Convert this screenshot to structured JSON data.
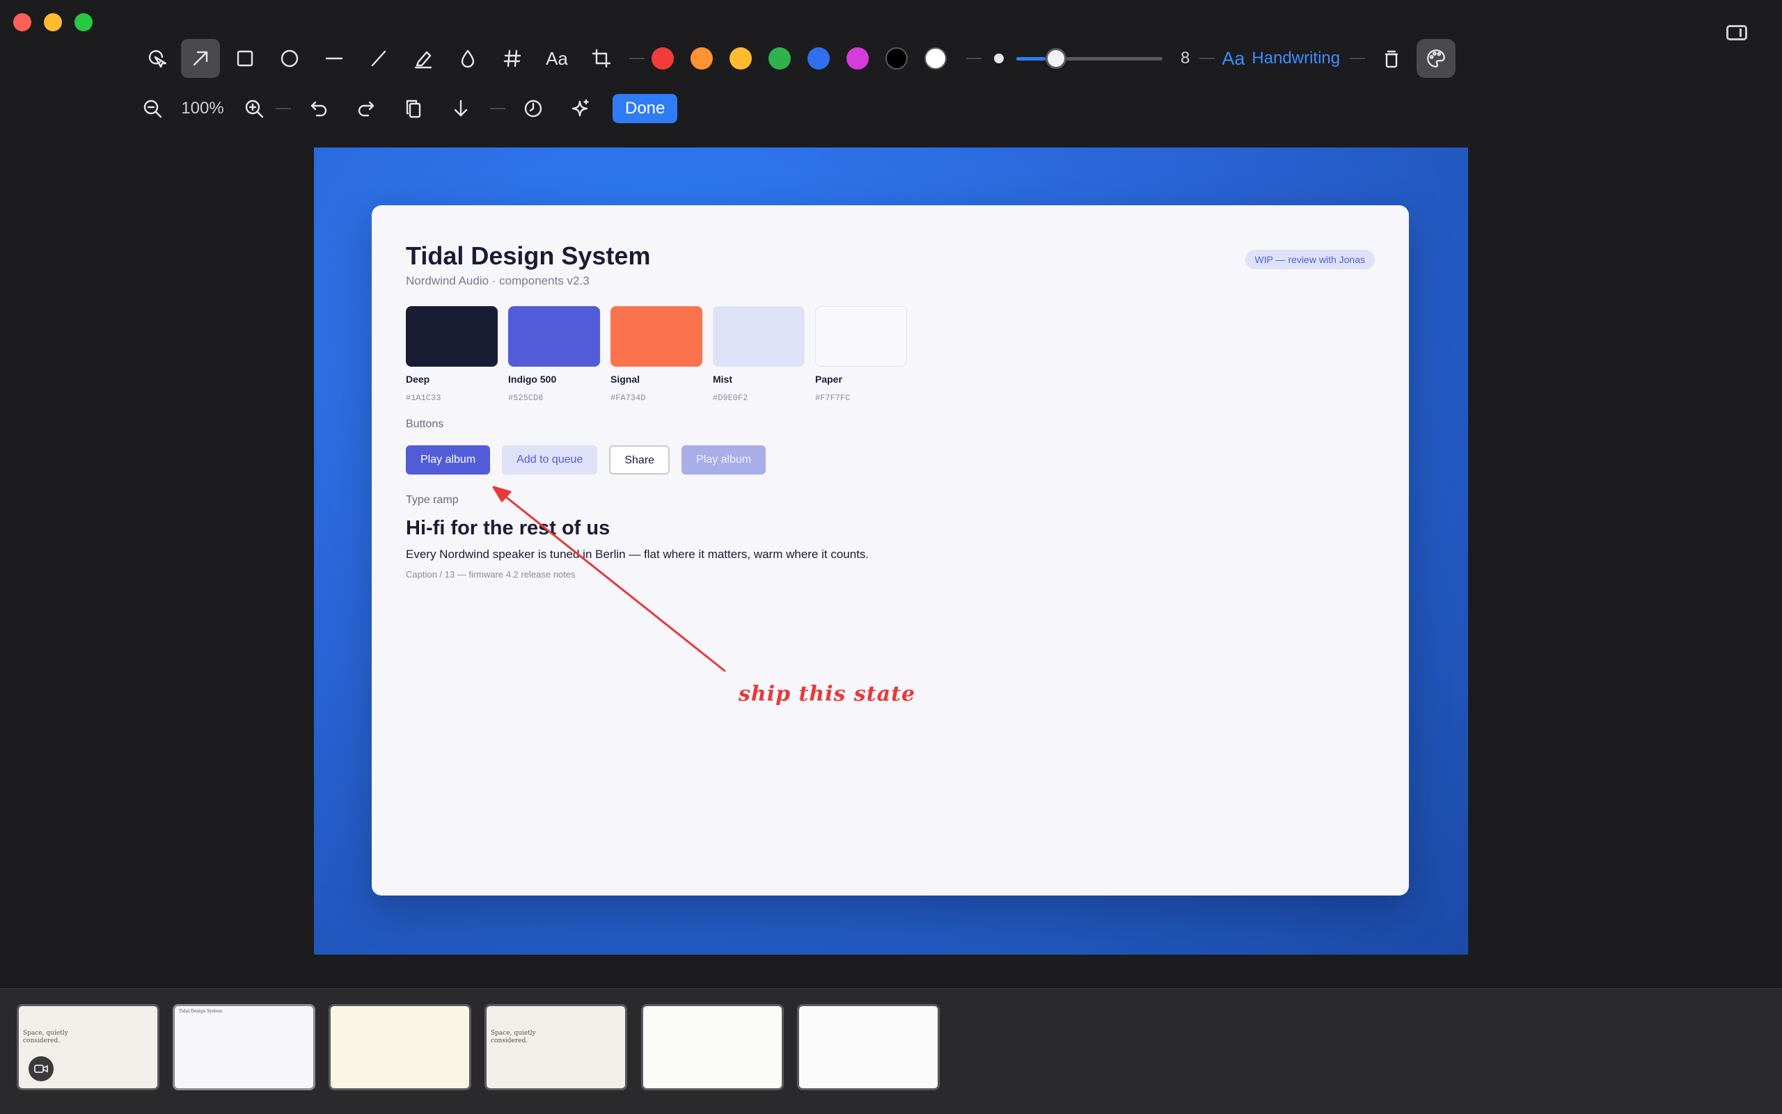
{
  "toolbar": {
    "zoom": "100%",
    "stroke_size": "8",
    "stroke_size_fraction": 0.2,
    "font_style": "Handwriting",
    "font_prefix": "Aa",
    "text_tool": "Aa",
    "done_label": "Done",
    "colors": [
      "#f23c3c",
      "#ff9332",
      "#ffbb2d",
      "#2fb24c",
      "#2f6ff0",
      "#d63bdc",
      "#000000",
      "#ffffff"
    ]
  },
  "card": {
    "title": "Tidal Design System",
    "subtitle": "Nordwind Audio · components v2.3",
    "badge": "WIP — review with Jonas",
    "swatches": [
      {
        "name": "Deep",
        "hex": "#1A1C33",
        "color": "#1a1c33"
      },
      {
        "name": "Indigo 500",
        "hex": "#525CD8",
        "color": "#525cd8"
      },
      {
        "name": "Signal",
        "hex": "#FA734D",
        "color": "#fa734d"
      },
      {
        "name": "Mist",
        "hex": "#D9E0F2",
        "color": "#dfe2f6"
      },
      {
        "name": "Paper",
        "hex": "#F7F7FC",
        "color": "#f7f7fc"
      }
    ],
    "buttons_label": "Buttons",
    "buttons": [
      "Play album",
      "Add to queue",
      "Share",
      "Play album"
    ],
    "type_label": "Type ramp",
    "type_heading": "Hi-fi for the rest of us",
    "type_body": "Every Nordwind speaker is tuned in Berlin — flat where it matters, warm where it counts.",
    "type_caption": "Caption / 13 — firmware 4.2 release notes"
  },
  "annotation": {
    "text": "ship this state",
    "color": "#e63a3a"
  },
  "filmstrip": {
    "thumbs": [
      {
        "label": "Space, quietly considered.",
        "bg": "#f1efe9"
      },
      {
        "label": "Tidal Design System",
        "bg": "#f6f6fb"
      },
      {
        "label": "",
        "bg": "#faf6e6"
      },
      {
        "label": "Space, quietly considered.",
        "bg": "#f1efe9"
      },
      {
        "label": "",
        "bg": "#fbfbf8"
      },
      {
        "label": "",
        "bg": "#fbfbfb"
      }
    ]
  }
}
